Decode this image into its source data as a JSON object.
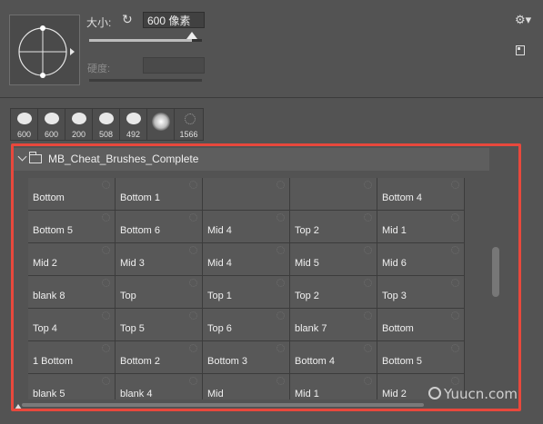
{
  "brush_settings": {
    "size_label": "大小:",
    "size_value": "600 像素",
    "size_slider_level": 0.91,
    "hardness_label": "硬度:"
  },
  "icons": {
    "reset": "reset-icon",
    "settings": "gear-icon",
    "new_brush": "new-brush-icon",
    "folder": "folder-icon"
  },
  "recent_brushes": [
    {
      "size": "600"
    },
    {
      "size": "600"
    },
    {
      "size": "200"
    },
    {
      "size": "508"
    },
    {
      "size": "492"
    },
    {
      "size": ""
    },
    {
      "size": "1566"
    }
  ],
  "brush_group": {
    "name": "MB_Cheat_Brushes_Complete",
    "rows": [
      [
        "Bottom",
        "Bottom 1",
        "",
        "",
        "Bottom 4"
      ],
      [
        "Bottom 5",
        "Bottom 6",
        "Mid 4",
        "Top 2",
        "Mid 1"
      ],
      [
        "Mid 2",
        "Mid 3",
        "Mid 4",
        "Mid 5",
        "Mid 6"
      ],
      [
        "blank 8",
        "Top",
        "Top 1",
        "Top 2",
        "Top 3"
      ],
      [
        "Top 4",
        "Top 5",
        "Top 6",
        "blank 7",
        "Bottom"
      ],
      [
        "1 Bottom",
        "Bottom 2",
        "Bottom 3",
        "Bottom 4",
        "Bottom 5"
      ],
      [
        "blank 5",
        "blank 4",
        "Mid",
        "Mid 1",
        "Mid 2"
      ]
    ]
  },
  "watermark": "Yuucn.com",
  "highlight_color": "#e8483c"
}
